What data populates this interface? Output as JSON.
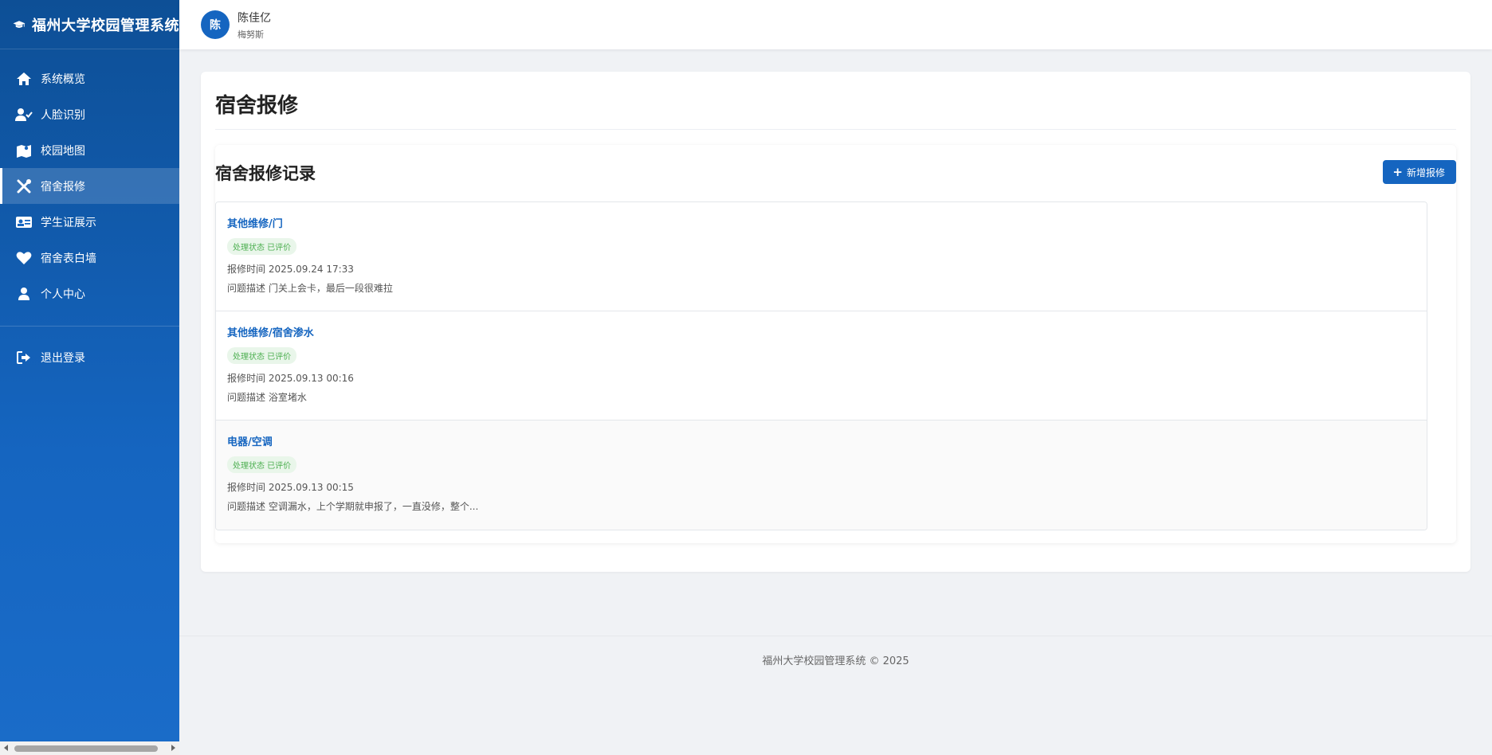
{
  "sidebar": {
    "brand_title": "福州大学校园管理系统",
    "items": [
      {
        "label": "系统概览",
        "icon": "home-icon"
      },
      {
        "label": "人脸识别",
        "icon": "user-check-icon"
      },
      {
        "label": "校园地图",
        "icon": "map-icon"
      },
      {
        "label": "宿舍报修",
        "icon": "tools-icon",
        "active": true
      },
      {
        "label": "学生证展示",
        "icon": "id-card-icon"
      },
      {
        "label": "宿舍表白墙",
        "icon": "heart-icon"
      },
      {
        "label": "个人中心",
        "icon": "user-icon"
      }
    ],
    "logout_label": "退出登录"
  },
  "header": {
    "avatar_char": "陈",
    "user_name": "陈佳亿",
    "user_sub": "梅努斯"
  },
  "main": {
    "page_title": "宿舍报修",
    "records_title": "宿舍报修记录",
    "add_button_label": "新增报修",
    "records": [
      {
        "category": "其他维修/门",
        "status": "处理状态 已评价",
        "time": "报修时间 2025.09.24 17:33",
        "desc": "问题描述 门关上会卡，最后一段很难拉"
      },
      {
        "category": "其他维修/宿舍渗水",
        "status": "处理状态 已评价",
        "time": "报修时间 2025.09.13 00:16",
        "desc": "问题描述 浴室堵水"
      },
      {
        "category": "电器/空调",
        "status": "处理状态 已评价",
        "time": "报修时间 2025.09.13 00:15",
        "desc": "问题描述 空调漏水，上个学期就申报了，一直没修，整个..."
      }
    ]
  },
  "footer": {
    "text": "福州大学校园管理系统 © 2025"
  },
  "colors": {
    "primary": "#1565c0",
    "sidebar_top": "#0d4f96",
    "status_green": "#4caf50",
    "background": "#f0f2f5"
  }
}
